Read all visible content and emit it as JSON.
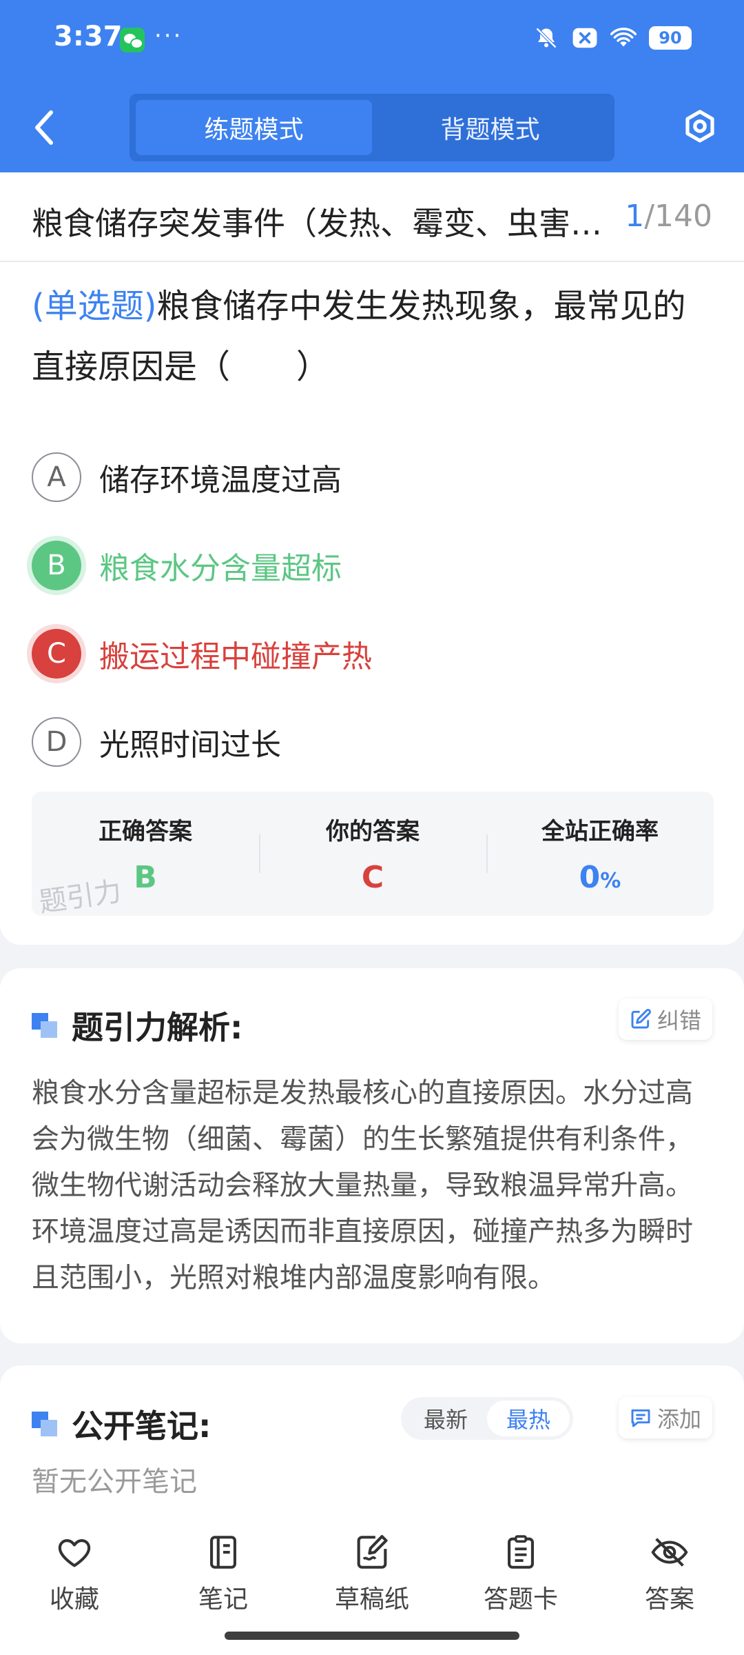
{
  "status_bar": {
    "time": "3:37",
    "dots": "···",
    "battery": "90"
  },
  "header": {
    "tabs": [
      {
        "label": "练题模式",
        "active": true
      },
      {
        "label": "背题模式",
        "active": false
      }
    ]
  },
  "question_header": {
    "title": "粮食储存突发事件（发热、霉变、虫害）处理",
    "current": "1",
    "total": "/140"
  },
  "question": {
    "type_tag": "(单选题)",
    "text": "粮食储存中发生发热现象，最常见的直接原因是（　　）",
    "options": [
      {
        "letter": "A",
        "text": "储存环境温度过高",
        "state": "normal"
      },
      {
        "letter": "B",
        "text": "粮食水分含量超标",
        "state": "correct"
      },
      {
        "letter": "C",
        "text": "搬运过程中碰撞产热",
        "state": "wrong"
      },
      {
        "letter": "D",
        "text": "光照时间过长",
        "state": "normal"
      }
    ]
  },
  "stats": {
    "correct_label": "正确答案",
    "correct_value": "B",
    "mine_label": "你的答案",
    "mine_value": "C",
    "rate_label": "全站正确率",
    "rate_value": "0",
    "rate_unit": "%"
  },
  "watermark": "题引力",
  "analysis": {
    "title": "题引力解析:",
    "report_label": "纠错",
    "text": "粮食水分含量超标是发热最核心的直接原因。水分过高会为微生物（细菌、霉菌）的生长繁殖提供有利条件，微生物代谢活动会释放大量热量，导致粮温异常升高。环境温度过高是诱因而非直接原因，碰撞产热多为瞬时且范围小，光照对粮堆内部温度影响有限。"
  },
  "notes": {
    "title": "公开笔记:",
    "sort_latest": "最新",
    "sort_hot": "最热",
    "add_label": "添加",
    "empty_text": "暂无公开笔记"
  },
  "bottom_tabs": [
    {
      "label": "收藏",
      "icon": "heart-icon"
    },
    {
      "label": "笔记",
      "icon": "notebook-icon"
    },
    {
      "label": "草稿纸",
      "icon": "draft-paper-icon"
    },
    {
      "label": "答题卡",
      "icon": "answer-card-icon"
    },
    {
      "label": "答案",
      "icon": "eye-off-icon"
    }
  ],
  "colors": {
    "primary": "#3d82f0",
    "correct": "#5cc783",
    "wrong": "#d8413d"
  }
}
